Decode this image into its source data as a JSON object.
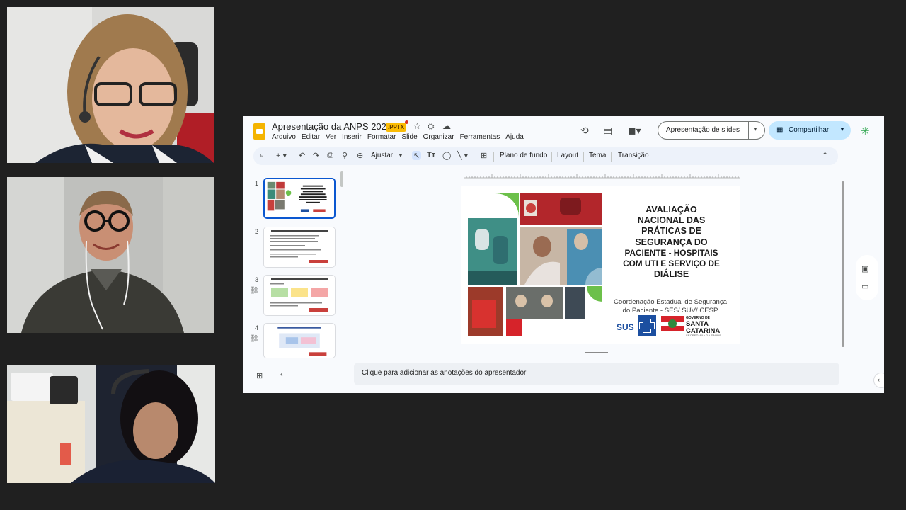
{
  "app": {
    "doc_title": "Apresentação da ANPS 2025",
    "file_badge": ".PPTX",
    "menu": [
      "Arquivo",
      "Editar",
      "Ver",
      "Inserir",
      "Formatar",
      "Slide",
      "Organizar",
      "Ferramentas",
      "Ajuda"
    ],
    "present_label": "Apresentação de slides",
    "share_label": "Compartilhar"
  },
  "toolbar": {
    "zoom_label": "Ajustar",
    "background_label": "Plano de fundo",
    "layout_label": "Layout",
    "theme_label": "Tema",
    "transition_label": "Transição"
  },
  "filmstrip": {
    "numbers": [
      "1",
      "2",
      "3",
      "4"
    ]
  },
  "slide": {
    "title_lines": [
      "AVALIAÇÃO",
      "NACIONAL DAS",
      "PRÁTICAS DE",
      "SEGURANÇA DO",
      "PACIENTE - HOSPITAIS",
      "COM UTI E SERVIÇO DE",
      "DIÁLISE"
    ],
    "subtitle_lines": [
      "Coordenação Estadual de Segurança",
      "do Paciente - SES/ SUV/ CESP"
    ],
    "logo_sus": "SUS",
    "logo_gov_small": "GOVERNO DE",
    "logo_gov_big": [
      "SANTA",
      "CATARINA"
    ],
    "logo_gov_sec": "SECRETARIA DA SAÚDE"
  },
  "notes": {
    "placeholder": "Clique para adicionar as anotações do apresentador"
  },
  "colors": {
    "accent_blue": "#0b57d0",
    "share_bg": "#c2e7ff",
    "slides_yellow": "#f4b400",
    "slide_green": "#6cc04a",
    "slide_red": "#d6232a"
  }
}
